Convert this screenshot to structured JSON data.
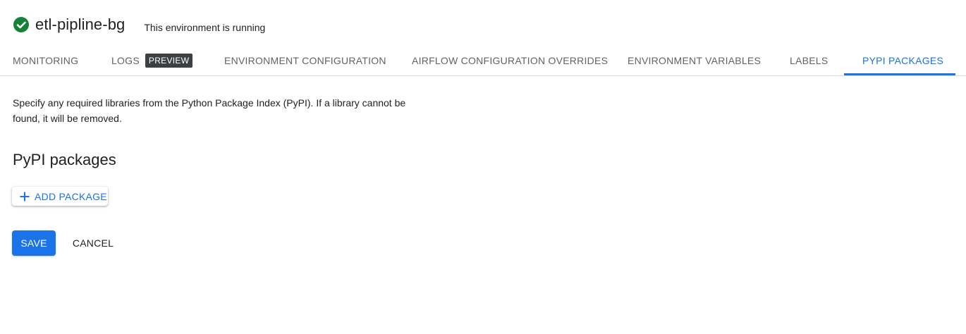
{
  "header": {
    "env_name": "etl-pipline-bg",
    "status_text": "This environment is running",
    "status_icon": "check-circle-icon",
    "status_color": "#188038"
  },
  "tabs": [
    {
      "label": "MONITORING",
      "active": false
    },
    {
      "label": "LOGS",
      "badge": "PREVIEW",
      "active": false
    },
    {
      "label": "ENVIRONMENT CONFIGURATION",
      "active": false
    },
    {
      "label": "AIRFLOW CONFIGURATION OVERRIDES",
      "active": false
    },
    {
      "label": "ENVIRONMENT VARIABLES",
      "active": false
    },
    {
      "label": "LABELS",
      "active": false
    },
    {
      "label": "PYPI PACKAGES",
      "active": true
    }
  ],
  "main": {
    "description": "Specify any required libraries from the Python Package Index (PyPI). If a library cannot be found, it will be removed.",
    "section_title": "PyPI packages",
    "add_package_label": "ADD PACKAGE",
    "add_package_icon": "plus-icon"
  },
  "actions": {
    "save_label": "SAVE",
    "cancel_label": "CANCEL"
  },
  "colors": {
    "accent": "#1a73e8",
    "badge_bg": "#3c4043",
    "tab_text": "#5f6368"
  }
}
